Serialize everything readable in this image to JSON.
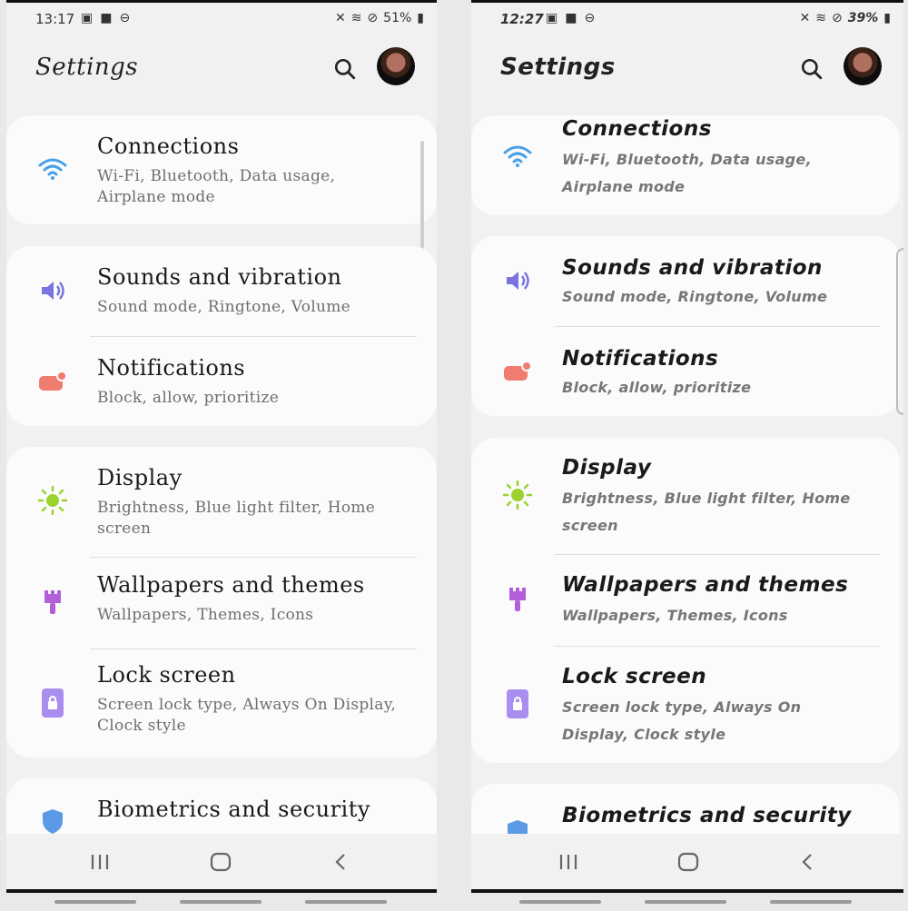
{
  "left": {
    "status": {
      "time": "13:17",
      "battery": "51%"
    },
    "title": "Settings",
    "items": [
      {
        "label": "Connections",
        "sub": "Wi-Fi, Bluetooth, Data usage, Airplane mode"
      },
      {
        "label": "Sounds and vibration",
        "sub": "Sound mode, Ringtone, Volume"
      },
      {
        "label": "Notifications",
        "sub": "Block, allow, prioritize"
      },
      {
        "label": "Display",
        "sub": "Brightness, Blue light filter, Home screen"
      },
      {
        "label": "Wallpapers and themes",
        "sub": "Wallpapers, Themes, Icons"
      },
      {
        "label": "Lock screen",
        "sub": "Screen lock type, Always On Display, Clock style"
      },
      {
        "label": "Biometrics and security",
        "sub": ""
      }
    ]
  },
  "right": {
    "status": {
      "time": "12:27",
      "battery": "39%"
    },
    "title": "Settings",
    "items": [
      {
        "label": "Connections",
        "sub": "Wi-Fi, Bluetooth, Data usage, Airplane mode"
      },
      {
        "label": "Sounds and vibration",
        "sub": "Sound mode, Ringtone, Volume"
      },
      {
        "label": "Notifications",
        "sub": "Block, allow, prioritize"
      },
      {
        "label": "Display",
        "sub": "Brightness, Blue light filter, Home screen"
      },
      {
        "label": "Wallpapers and themes",
        "sub": "Wallpapers, Themes, Icons"
      },
      {
        "label": "Lock screen",
        "sub": "Screen lock type, Always On Display, Clock style"
      },
      {
        "label": "Biometrics and security",
        "sub": ""
      }
    ]
  },
  "icons": {
    "wifi": "wifi-icon",
    "sound": "volume-icon",
    "notifications": "notification-icon",
    "display": "brightness-icon",
    "wallpaper": "paintbrush-icon",
    "lock": "lock-icon",
    "shield": "shield-icon"
  },
  "colors": {
    "wifi": "#4aa0e8",
    "sound": "#7a74e0",
    "notifications": "#ef7c6e",
    "display": "#9bd22e",
    "wallpaper": "#b25fdc",
    "lock": "#a98ef0",
    "shield": "#5b9ae6"
  }
}
